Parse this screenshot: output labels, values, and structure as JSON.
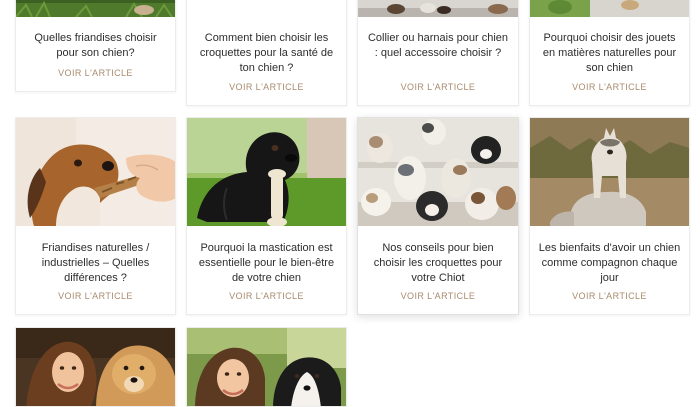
{
  "articles": [
    {
      "title": "Quelles friandises choisir pour son chien?",
      "link": "VOIR L'ARTICLE",
      "image": "dog-on-grass-photo"
    },
    {
      "title": "Comment bien choisir les croquettes pour la santé de ton chien ?",
      "link": "VOIR L'ARTICLE",
      "image": "blank-photo"
    },
    {
      "title": "Collier ou harnais pour chien : quel accessoire choisir ?",
      "link": "VOIR L'ARTICLE",
      "image": "dogs-on-floor-photo"
    },
    {
      "title": "Pourquoi choisir des jouets en matières naturelles pour son chien",
      "link": "VOIR L'ARTICLE",
      "image": "dog-toy-outdoor-photo"
    },
    {
      "title": "Friandises naturelles / industrielles – Quelles différences ?",
      "link": "VOIR L'ARTICLE",
      "image": "beagle-chew-treat-photo"
    },
    {
      "title": "Pourquoi la mastication est essentielle pour le bien-être de votre chien",
      "link": "VOIR L'ARTICLE",
      "image": "black-labrador-bone-photo"
    },
    {
      "title": "Nos conseils pour bien choisir les croquettes pour votre Chiot",
      "link": "VOIR L'ARTICLE",
      "image": "puppies-group-photo"
    },
    {
      "title": "Les bienfaits d'avoir un chien comme compagnon chaque jour",
      "link": "VOIR L'ARTICLE",
      "image": "husky-on-rock-photo"
    },
    {
      "title": "",
      "link": "",
      "image": "woman-with-fluffy-dog-photo"
    },
    {
      "title": "",
      "link": "",
      "image": "woman-with-border-collie-photo"
    }
  ],
  "colors": {
    "accent": "#a88b6e",
    "title_text": "#2d2d2d",
    "card_border": "#ececec"
  }
}
